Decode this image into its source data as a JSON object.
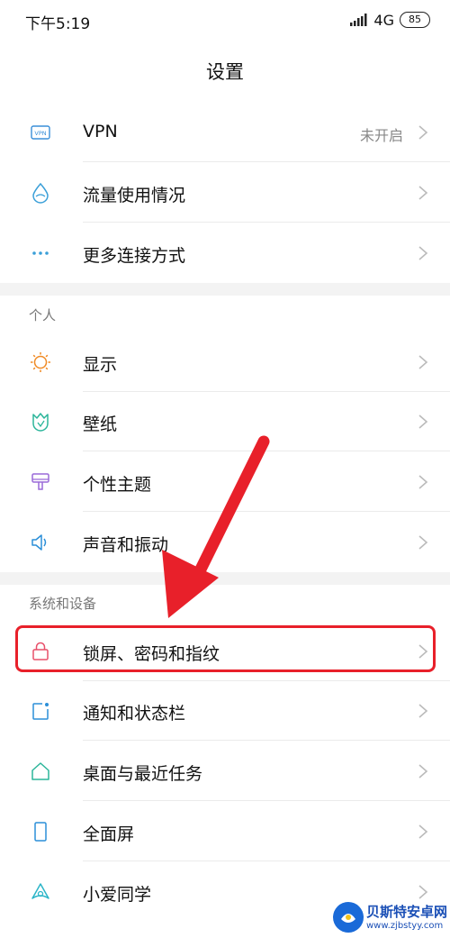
{
  "status_bar": {
    "time": "下午5:19",
    "network": "4G",
    "battery": "85"
  },
  "header": {
    "title": "设置"
  },
  "network_items": [
    {
      "label": "VPN",
      "value": "未开启",
      "icon": "vpn-icon"
    },
    {
      "label": "流量使用情况",
      "icon": "data-usage-icon"
    },
    {
      "label": "更多连接方式",
      "icon": "more-dots-icon"
    }
  ],
  "personal": {
    "title": "个人",
    "items": [
      {
        "label": "显示",
        "icon": "sun-icon"
      },
      {
        "label": "壁纸",
        "icon": "wallpaper-icon"
      },
      {
        "label": "个性主题",
        "icon": "theme-brush-icon"
      },
      {
        "label": "声音和振动",
        "icon": "speaker-icon"
      }
    ]
  },
  "system": {
    "title": "系统和设备",
    "items": [
      {
        "label": "锁屏、密码和指纹",
        "icon": "lock-icon"
      },
      {
        "label": "通知和状态栏",
        "icon": "notification-icon"
      },
      {
        "label": "桌面与最近任务",
        "icon": "home-icon"
      },
      {
        "label": "全面屏",
        "icon": "phone-icon"
      },
      {
        "label": "小爱同学",
        "icon": "xiaoai-icon"
      }
    ]
  },
  "watermark": {
    "name": "贝斯特安卓网",
    "url": "www.zjbstyy.com"
  },
  "colors": {
    "highlight": "#e8202a",
    "arrow": "#e8202a",
    "section_gap": "#f3f3f3"
  }
}
